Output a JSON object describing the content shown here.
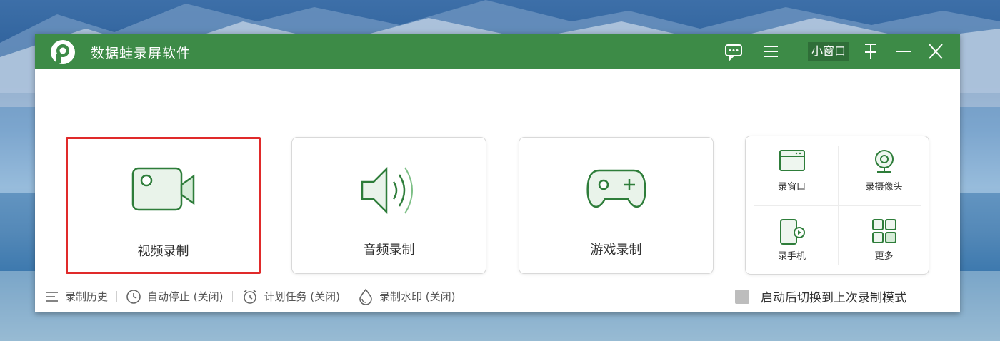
{
  "window": {
    "title": "数据蛙录屏软件",
    "mini_window": "小窗口",
    "accent": "#3d8b47"
  },
  "cards": [
    {
      "label": "视频录制",
      "icon": "video-camera-icon",
      "selected": true
    },
    {
      "label": "音频录制",
      "icon": "speaker-icon",
      "selected": false
    },
    {
      "label": "游戏录制",
      "icon": "gamepad-icon",
      "selected": false
    }
  ],
  "more_panel": [
    {
      "label": "录窗口",
      "icon": "window-icon"
    },
    {
      "label": "录摄像头",
      "icon": "webcam-icon"
    },
    {
      "label": "录手机",
      "icon": "phone-icon"
    },
    {
      "label": "更多",
      "icon": "grid-icon"
    }
  ],
  "restore_option": {
    "label": "启动后切换到上次录制模式",
    "checked": false
  },
  "footer": [
    {
      "label": "录制历史",
      "icon": "list-icon"
    },
    {
      "label": "自动停止 (关闭)",
      "icon": "clock-icon"
    },
    {
      "label": "计划任务 (关闭)",
      "icon": "alarm-icon"
    },
    {
      "label": "录制水印 (关闭)",
      "icon": "watermark-drop-icon"
    }
  ],
  "selection_color": "#e02a2a"
}
